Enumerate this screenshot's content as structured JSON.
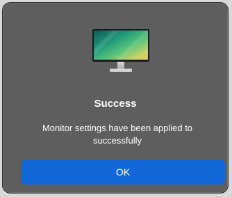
{
  "dialog": {
    "icon": "monitor-icon",
    "title": "Success",
    "message": "Monitor settings have been applied to\nsuccessfully",
    "ok_label": "OK"
  },
  "colors": {
    "dialog_background": "#5f5e5e",
    "button_accent": "#1268d9",
    "text": "#ffffff"
  }
}
